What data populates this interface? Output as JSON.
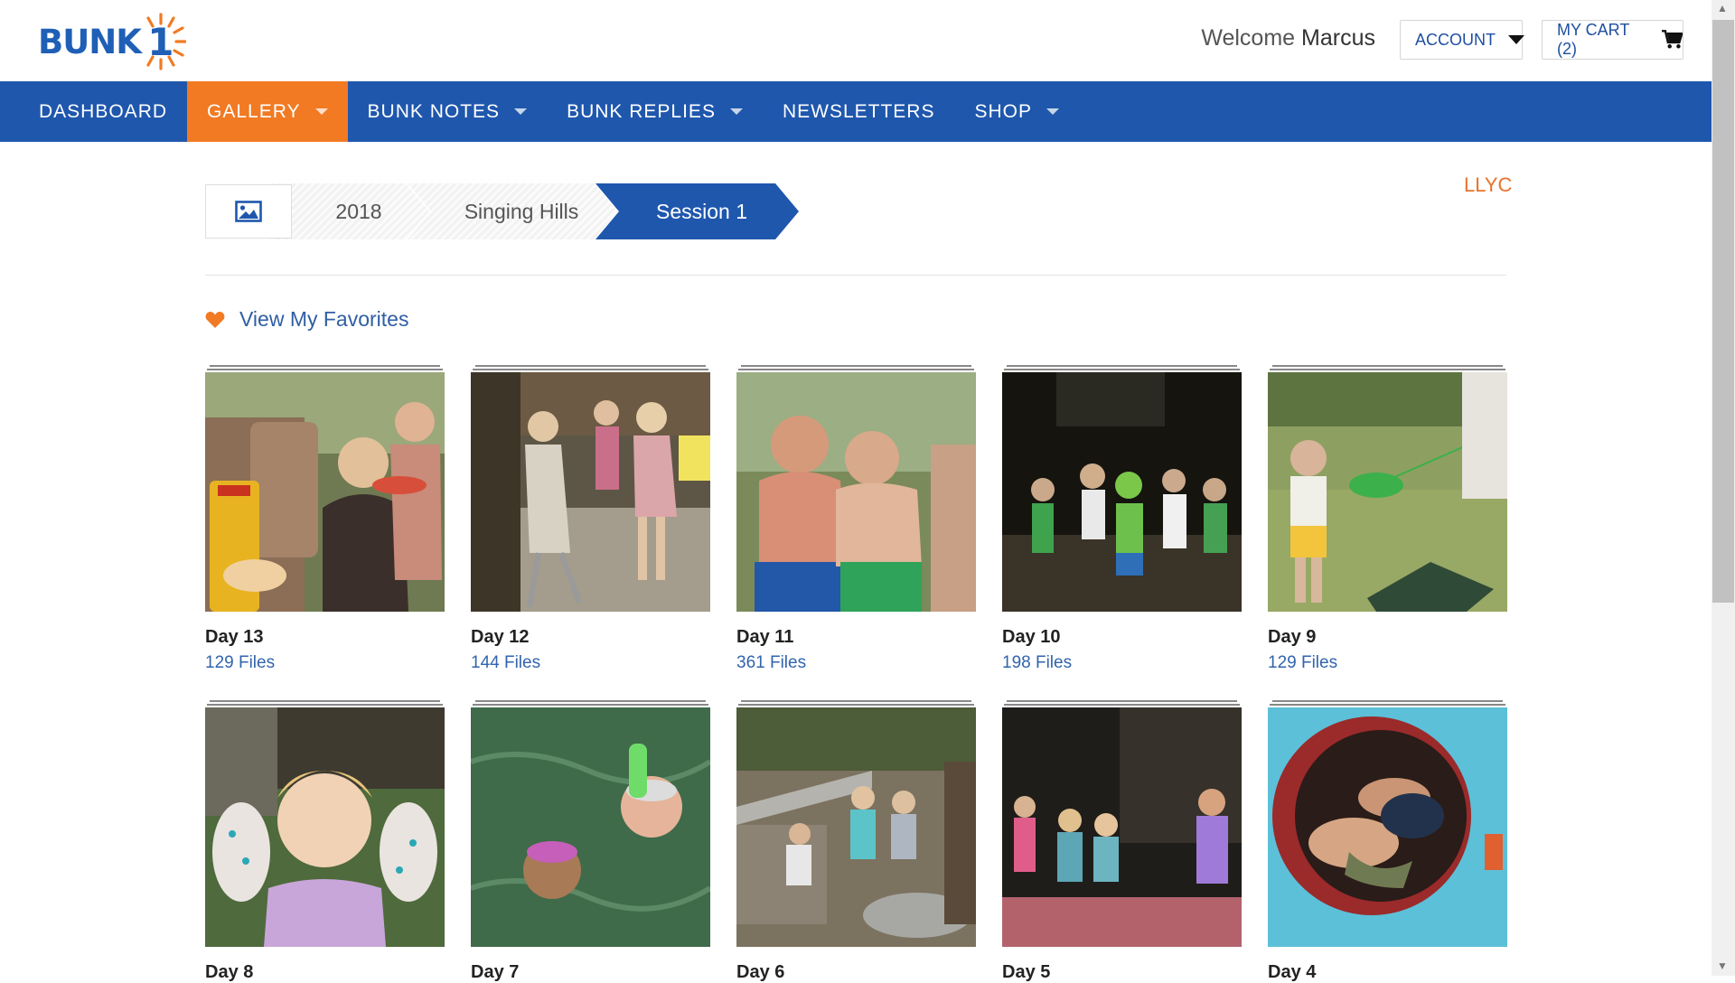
{
  "brand": {
    "logo_text": "BUNK",
    "logo_number": "1"
  },
  "header": {
    "welcome_prefix": "Welcome",
    "user_name": "Marcus",
    "account_label": "ACCOUNT",
    "cart_label": "MY CART (2)"
  },
  "nav": {
    "items": [
      {
        "label": "DASHBOARD"
      },
      {
        "label": "GALLERY"
      },
      {
        "label": "BUNK NOTES"
      },
      {
        "label": "BUNK REPLIES"
      },
      {
        "label": "NEWSLETTERS"
      },
      {
        "label": "SHOP"
      }
    ]
  },
  "breadcrumb": {
    "home_icon": "image-icon",
    "year": "2018",
    "camp": "Singing Hills",
    "session": "Session 1"
  },
  "org_label": "LLYC",
  "favorites": {
    "label": "View My Favorites",
    "icon": "heart-icon"
  },
  "albums": [
    {
      "title": "Day 13",
      "count": "129 Files"
    },
    {
      "title": "Day 12",
      "count": "144 Files"
    },
    {
      "title": "Day 11",
      "count": "361 Files"
    },
    {
      "title": "Day 10",
      "count": "198 Files"
    },
    {
      "title": "Day 9",
      "count": "129 Files"
    },
    {
      "title": "Day 8",
      "count": ""
    },
    {
      "title": "Day 7",
      "count": ""
    },
    {
      "title": "Day 6",
      "count": ""
    },
    {
      "title": "Day 5",
      "count": ""
    },
    {
      "title": "Day 4",
      "count": ""
    }
  ],
  "colors": {
    "brand_blue": "#1f57ad",
    "accent_orange": "#f17a23",
    "link_blue": "#3264ad"
  }
}
